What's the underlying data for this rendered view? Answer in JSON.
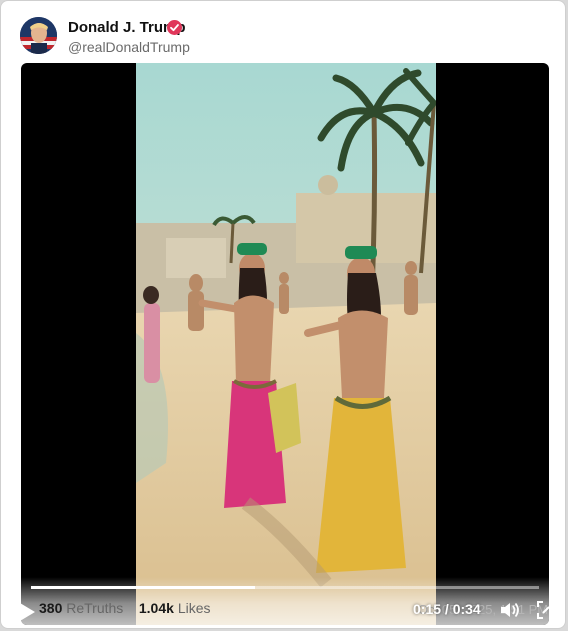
{
  "post": {
    "author_name": "Donald J. Trump",
    "author_handle": "@realDonaldTrump",
    "verified_icon": "verified-badge-icon",
    "avatar_icon": "avatar-photo"
  },
  "video": {
    "current_time": "0:15",
    "duration": "0:34",
    "time_display": "0:15 / 0:34",
    "progress_fraction": 0.44,
    "play_icon": "play-icon",
    "volume_icon": "volume-icon",
    "fullscreen_icon": "fullscreen-icon"
  },
  "stats": {
    "retruths_count": "380",
    "retruths_label": "ReTruths",
    "likes_count": "1.04k",
    "likes_label": "Likes"
  },
  "meta": {
    "timestamp": "Oct 05, 2025, 1:51 PM"
  },
  "colors": {
    "verified": "#e0365a",
    "background": "#ffffff",
    "video_bg": "#000000",
    "sky": "#9fd3cf",
    "sand": "#e9d3ad"
  }
}
